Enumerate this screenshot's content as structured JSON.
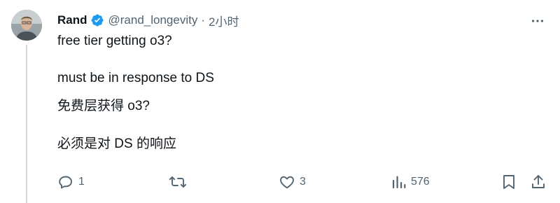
{
  "tweet": {
    "author_name": "Rand",
    "handle": "@rand_longevity",
    "separator": "·",
    "time": "2小时",
    "lines": [
      "free tier getting o3?",
      "must be in response to DS",
      "免费层获得 o3?",
      "必须是对 DS 的响应"
    ]
  },
  "actions": {
    "reply_count": "1",
    "retweet_count": "",
    "like_count": "3",
    "views_count": "576"
  },
  "colors": {
    "verified_badge": "#1d9bf0",
    "muted": "#536471",
    "thread_line": "#cfd9de"
  },
  "icons": [
    "verified-badge-icon",
    "more-options-icon",
    "reply-icon",
    "retweet-icon",
    "like-icon",
    "views-icon",
    "bookmark-icon",
    "share-icon"
  ]
}
